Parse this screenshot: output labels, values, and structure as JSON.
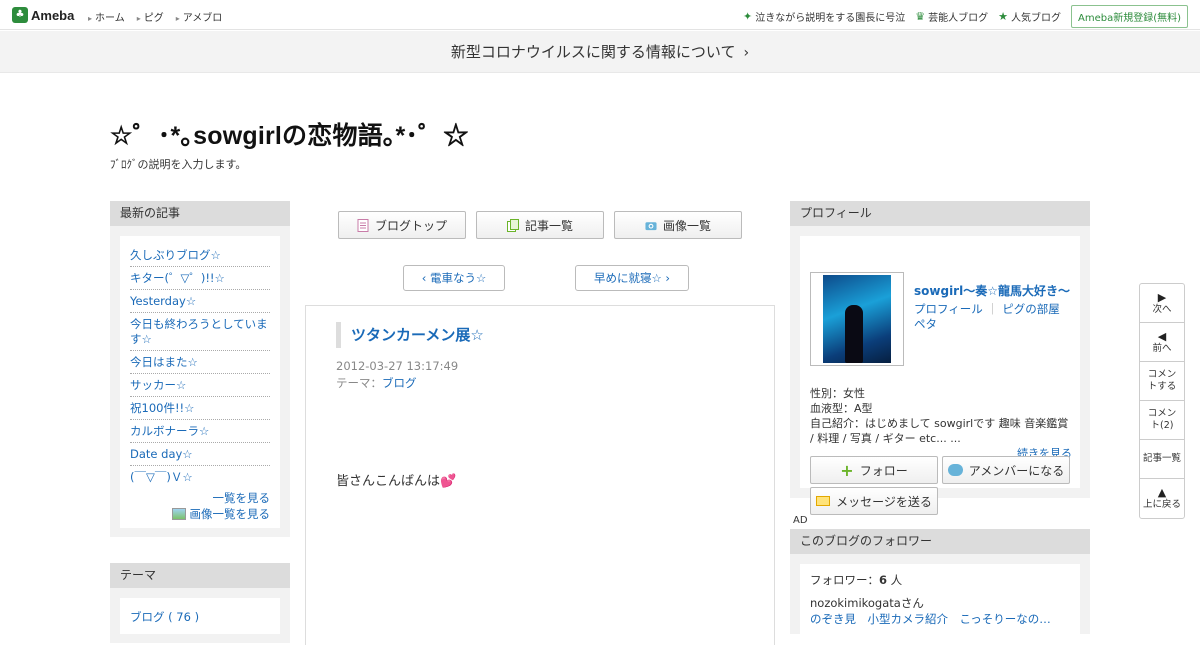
{
  "header": {
    "logo_text": "Ameba",
    "nav": [
      "ホーム",
      "ピグ",
      "アメブロ"
    ],
    "right_links": [
      {
        "icon": "sparkle-icon",
        "label": "泣きながら説明をする園長に号泣"
      },
      {
        "icon": "crown-icon",
        "label": "芸能人ブログ"
      },
      {
        "icon": "star-icon",
        "label": "人気ブログ"
      }
    ],
    "register_label": "Ameba新規登録(無料)"
  },
  "notice": {
    "label": "新型コロナウイルスに関する情報について",
    "chevron": "›"
  },
  "blog": {
    "title": "☆゜･*｡sowgirlの恋物語｡*･゜☆",
    "description": "ﾌﾞﾛｸﾞの説明を入力します。"
  },
  "left_sidebar": {
    "recent": {
      "heading": "最新の記事",
      "items": [
        "久しぶりブログ☆",
        "キター(゜▽゜)!!☆",
        "Yesterday☆",
        "今日も終わろうとしています☆",
        "今日はまた☆",
        "サッカー☆",
        "祝100件!!☆",
        "カルボナーラ☆",
        "Date day☆",
        "(￣▽￣)Ｖ☆"
      ],
      "see_all": "一覧を見る",
      "see_images": "画像一覧を見る"
    },
    "theme": {
      "heading": "テーマ",
      "items": [
        "ブログ ( 76 )"
      ]
    }
  },
  "center": {
    "buttons": {
      "top": "ブログトップ",
      "list": "記事一覧",
      "images": "画像一覧"
    },
    "prev_label": "‹ 電車なう☆",
    "next_label": "早めに就寝☆ ›",
    "article": {
      "title": "ツタンカーメン展☆",
      "date": "2012-03-27 13:17:49",
      "theme_label": "テーマ：",
      "theme_value": "ブログ",
      "body": "皆さんこんばんは"
    }
  },
  "profile": {
    "heading": "プロフィール",
    "name": "sowgirl～奏☆龍馬大好き～",
    "links": {
      "profile": "プロフィール",
      "pig": "ピグの部屋",
      "peta": "ペタ",
      "sep": "｜"
    },
    "info": {
      "gender": "性別：女性",
      "blood": "血液型：A型",
      "intro": "自己紹介：はじめまして sowgirlです 趣味 音楽鑑賞 / 料理 / 写真 / ギター etc... ...",
      "more": "続きを見る"
    },
    "buttons": {
      "follow": "フォロー",
      "amember": "アメンバーになる",
      "message": "メッセージを送る"
    }
  },
  "ad_label": "AD",
  "followers": {
    "heading": "このブログのフォロワー",
    "count_label": "フォロワー：",
    "count": "6",
    "count_unit": "人",
    "user": "nozokimikogata",
    "user_suffix": "さん",
    "user_links": "のぞき見　小型カメラ紹介　こっそりーなの…"
  },
  "floatnav": [
    {
      "icon": "triangle-right-icon",
      "label": "次へ"
    },
    {
      "icon": "triangle-left-icon",
      "label": "前へ"
    },
    {
      "icon": "",
      "label": "コメントする"
    },
    {
      "icon": "",
      "label": "コメント(2)"
    },
    {
      "icon": "",
      "label": "記事一覧"
    },
    {
      "icon": "triangle-up-icon",
      "label": "上に戻る"
    }
  ],
  "colors": {
    "accent": "#1a6ab8",
    "brand": "#2d8c3c",
    "heading_bg": "#dcdcdc"
  }
}
